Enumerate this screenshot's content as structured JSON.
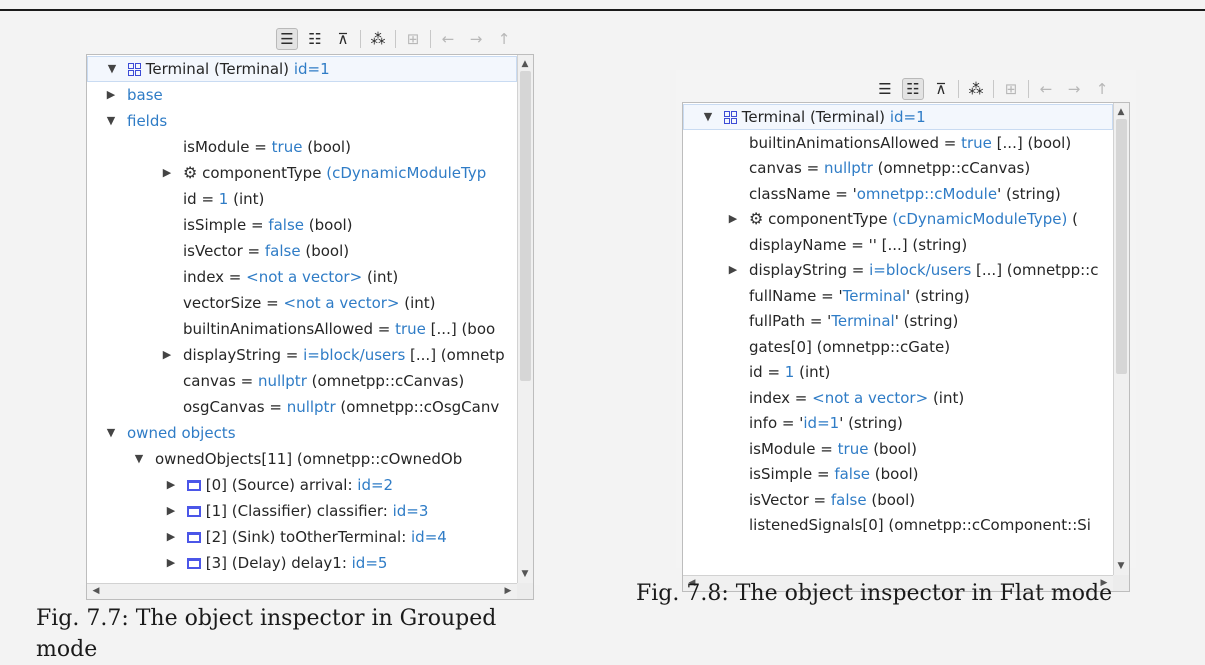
{
  "colors": {
    "accent_blue": "#2f7cc6",
    "window_icon": "#4b56e8",
    "selection": "#f3f7fd"
  },
  "toolbar_icons": [
    "children-mode-icon",
    "grouped-mode-icon",
    "flat-mode-icon",
    "inheritance-mode-icon",
    "layout-icon",
    "back-arrow-icon",
    "forward-arrow-icon",
    "up-arrow-icon"
  ],
  "grouped": {
    "rows": [
      {
        "twisty": "▼",
        "icon": "module",
        "parts": [
          [
            "Terminal (Terminal) ",
            ""
          ],
          [
            "id=1",
            "b"
          ]
        ]
      },
      {
        "twisty": "▶",
        "parts": [
          [
            "base",
            "b"
          ]
        ]
      },
      {
        "twisty": "▼",
        "parts": [
          [
            "fields",
            "b"
          ]
        ]
      },
      {
        "parts": [
          [
            "isModule = ",
            ""
          ],
          [
            "true",
            "b"
          ],
          [
            " (bool)",
            ""
          ]
        ]
      },
      {
        "twisty": "▶",
        "icon": "gear",
        "parts": [
          [
            "componentType ",
            ""
          ],
          [
            "(cDynamicModuleTyp",
            "b"
          ]
        ]
      },
      {
        "parts": [
          [
            "id = ",
            ""
          ],
          [
            "1",
            "b"
          ],
          [
            " (int)",
            ""
          ]
        ]
      },
      {
        "parts": [
          [
            "isSimple = ",
            ""
          ],
          [
            "false",
            "b"
          ],
          [
            " (bool)",
            ""
          ]
        ]
      },
      {
        "parts": [
          [
            "isVector = ",
            ""
          ],
          [
            "false",
            "b"
          ],
          [
            " (bool)",
            ""
          ]
        ]
      },
      {
        "parts": [
          [
            "index = ",
            ""
          ],
          [
            "<not a vector>",
            "b"
          ],
          [
            " (int)",
            ""
          ]
        ]
      },
      {
        "parts": [
          [
            "vectorSize = ",
            ""
          ],
          [
            "<not a vector>",
            "b"
          ],
          [
            " (int)",
            ""
          ]
        ]
      },
      {
        "parts": [
          [
            "builtinAnimationsAllowed = ",
            ""
          ],
          [
            "true",
            "b"
          ],
          [
            " [...] (boo",
            ""
          ]
        ]
      },
      {
        "twisty": "▶",
        "parts": [
          [
            "displayString = ",
            ""
          ],
          [
            "i=block/users",
            "b"
          ],
          [
            " [...] (omnetp",
            ""
          ]
        ]
      },
      {
        "parts": [
          [
            "canvas = ",
            ""
          ],
          [
            "nullptr",
            "b"
          ],
          [
            " (omnetpp::cCanvas)",
            ""
          ]
        ]
      },
      {
        "parts": [
          [
            "osgCanvas = ",
            ""
          ],
          [
            "nullptr",
            "b"
          ],
          [
            " (omnetpp::cOsgCanv",
            ""
          ]
        ]
      },
      {
        "twisty": "▼",
        "parts": [
          [
            "owned objects",
            "b"
          ]
        ]
      },
      {
        "twisty": "▼",
        "parts": [
          [
            "ownedObjects[11] (omnetpp::cOwnedOb",
            ""
          ]
        ]
      },
      {
        "twisty": "▶",
        "icon": "window",
        "parts": [
          [
            "[0] (Source) arrival: ",
            ""
          ],
          [
            "id=2",
            "b"
          ]
        ]
      },
      {
        "twisty": "▶",
        "icon": "window",
        "parts": [
          [
            "[1] (Classifier) classifier: ",
            ""
          ],
          [
            "id=3",
            "b"
          ]
        ]
      },
      {
        "twisty": "▶",
        "icon": "window",
        "parts": [
          [
            "[2] (Sink) toOtherTerminal: ",
            ""
          ],
          [
            "id=4",
            "b"
          ]
        ]
      },
      {
        "twisty": "▶",
        "icon": "window",
        "parts": [
          [
            "[3] (Delay) delay1: ",
            ""
          ],
          [
            "id=5",
            "b"
          ]
        ]
      }
    ]
  },
  "flat": {
    "rows": [
      {
        "twisty": "▼",
        "icon": "module",
        "parts": [
          [
            "Terminal (Terminal) ",
            ""
          ],
          [
            "id=1",
            "b"
          ]
        ]
      },
      {
        "parts": [
          [
            "builtinAnimationsAllowed = ",
            ""
          ],
          [
            "true",
            "b"
          ],
          [
            " [...] (bool)",
            ""
          ]
        ]
      },
      {
        "parts": [
          [
            "canvas = ",
            ""
          ],
          [
            "nullptr",
            "b"
          ],
          [
            " (omnetpp::cCanvas)",
            ""
          ]
        ]
      },
      {
        "parts": [
          [
            "className = '",
            ""
          ],
          [
            "omnetpp::cModule",
            "b"
          ],
          [
            "' (string)",
            ""
          ]
        ]
      },
      {
        "twisty": "▶",
        "icon": "gear",
        "parts": [
          [
            "componentType ",
            ""
          ],
          [
            "(cDynamicModuleType)",
            "b"
          ],
          [
            " (",
            ""
          ]
        ]
      },
      {
        "parts": [
          [
            "displayName = '' [...] (string)",
            ""
          ]
        ]
      },
      {
        "twisty": "▶",
        "parts": [
          [
            "displayString = ",
            ""
          ],
          [
            "i=block/users",
            "b"
          ],
          [
            " [...] (omnetpp::c",
            ""
          ]
        ]
      },
      {
        "parts": [
          [
            "fullName = '",
            ""
          ],
          [
            "Terminal",
            "b"
          ],
          [
            "' (string)",
            ""
          ]
        ]
      },
      {
        "parts": [
          [
            "fullPath = '",
            ""
          ],
          [
            "Terminal",
            "b"
          ],
          [
            "' (string)",
            ""
          ]
        ]
      },
      {
        "parts": [
          [
            "gates[0] (omnetpp::cGate)",
            ""
          ]
        ]
      },
      {
        "parts": [
          [
            "id = ",
            ""
          ],
          [
            "1",
            "b"
          ],
          [
            " (int)",
            ""
          ]
        ]
      },
      {
        "parts": [
          [
            "index = ",
            ""
          ],
          [
            "<not a vector>",
            "b"
          ],
          [
            " (int)",
            ""
          ]
        ]
      },
      {
        "parts": [
          [
            "info = '",
            ""
          ],
          [
            "id=1",
            "b"
          ],
          [
            "' (string)",
            ""
          ]
        ]
      },
      {
        "parts": [
          [
            "isModule = ",
            ""
          ],
          [
            "true",
            "b"
          ],
          [
            " (bool)",
            ""
          ]
        ]
      },
      {
        "parts": [
          [
            "isSimple = ",
            ""
          ],
          [
            "false",
            "b"
          ],
          [
            " (bool)",
            ""
          ]
        ]
      },
      {
        "parts": [
          [
            "isVector = ",
            ""
          ],
          [
            "false",
            "b"
          ],
          [
            " (bool)",
            ""
          ]
        ]
      },
      {
        "parts": [
          [
            "listenedSignals[0] (omnetpp::cComponent::Si",
            ""
          ]
        ]
      }
    ]
  },
  "captions": {
    "grouped_line1": "Fig. 7.7: The object inspector in Grouped",
    "grouped_line2": "mode",
    "flat": "Fig. 7.8: The object inspector in Flat mode"
  }
}
